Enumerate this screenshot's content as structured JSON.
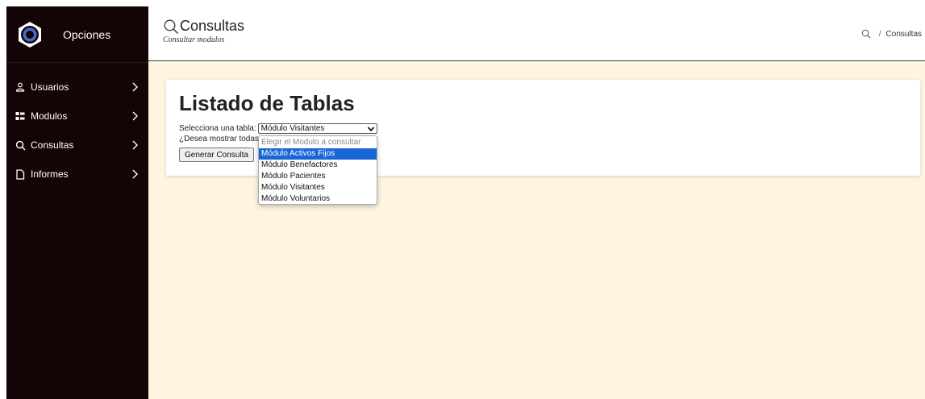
{
  "sidebar": {
    "brand_label": "Opciones",
    "items": [
      {
        "label": "Usuarios",
        "icon": "user-icon"
      },
      {
        "label": "Modulos",
        "icon": "modules-icon"
      },
      {
        "label": "Consultas",
        "icon": "search-icon"
      },
      {
        "label": "Informes",
        "icon": "document-icon"
      }
    ]
  },
  "header": {
    "title": "Consultas",
    "subtitle": "Consultar modulos",
    "breadcrumb_current": "Consultas",
    "breadcrumb_separator": "/"
  },
  "card": {
    "title": "Listado de Tablas",
    "select_label": "Selecciona una tabla:",
    "select_value": "Módulo Visitantes",
    "show_all_label": "¿Desea mostrar todas",
    "generate_button": "Generar Consulta"
  },
  "dropdown": {
    "options": [
      "Elegir el Modulo a consultar",
      "Módulo Activos Fijos",
      "Módulo Benefactores",
      "Módulo Pacientes",
      "Módulo Visitantes",
      "Módulo Voluntarios"
    ],
    "highlighted_option": "Módulo Activos Fijos"
  },
  "colors": {
    "sidebar_bg": "#150405",
    "content_bg": "#fdf4e2",
    "highlight": "#1a66d6"
  }
}
